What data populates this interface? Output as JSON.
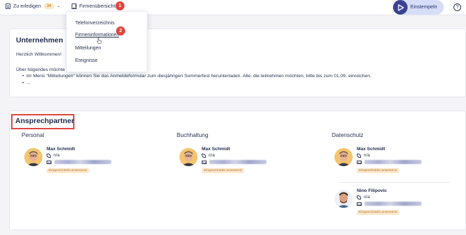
{
  "topbar": {
    "todo_label": "Zu erledigen",
    "todo_count": "34",
    "firmen_label": "Firmenübersicht",
    "callout_1": "1",
    "einstempeln_label": "Einstempeln",
    "help_symbol": "?"
  },
  "dropdown": {
    "items": [
      "Telefonverzeichnis",
      "Firmeninformationen",
      "Mitteilungen",
      "Ereignisse"
    ],
    "callout_2": "2"
  },
  "unternehmen": {
    "title": "Unternehmen",
    "welcome": "Herzlich Willkommen!",
    "intro": "Über folgendes möchte",
    "bullets": [
      "Im Menü \"Mitteilungen\" können Sie das Anmeldeformular zum diesjährigen Sommerfest herunterladen. Alle, die teilnehmen möchten, bitte bis zum 01.09. einreichen.",
      "..."
    ]
  },
  "ansprechpartner": {
    "title": "Ansprechpartner",
    "departments": [
      {
        "name": "Personal",
        "contacts": [
          {
            "name": "Max Schmidt",
            "phone": "n/a",
            "status": "Eingeschränkt anwesend"
          }
        ]
      },
      {
        "name": "Buchhaltung",
        "contacts": [
          {
            "name": "Max Schmidt",
            "phone": "n/a",
            "status": "Eingeschränkt anwesend"
          }
        ]
      },
      {
        "name": "Datenschutz",
        "contacts": [
          {
            "name": "Max Schmidt",
            "phone": "n/a",
            "status": "Eingeschränkt anwesend"
          },
          {
            "name": "Nino Filipovic",
            "phone": "n/a",
            "status": "Eingeschränkt anwesend"
          }
        ]
      }
    ]
  },
  "colors": {
    "accent": "#3a4391",
    "callout": "#e0453f",
    "status_bg": "#fde8cc",
    "status_text": "#b8762a"
  },
  "icons": [
    "document-icon",
    "grid-icon",
    "chevron-down-icon",
    "play-icon",
    "help-icon",
    "phone-icon",
    "mail-icon",
    "cursor-icon"
  ]
}
